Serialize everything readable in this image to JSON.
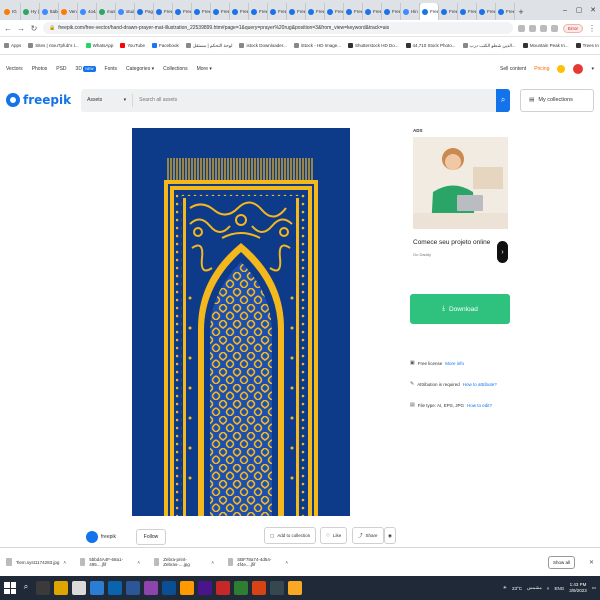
{
  "browser": {
    "tabs": [
      {
        "label": "IG",
        "fav": "o"
      },
      {
        "label": "Hy (3)",
        "fav": "g"
      },
      {
        "label": "ttabdi4",
        "fav": ""
      },
      {
        "label": "Vendor",
        "fav": "o"
      },
      {
        "label": "4o4ad",
        "fav": ""
      },
      {
        "label": "music",
        "fav": "g"
      },
      {
        "label": "studio",
        "fav": ""
      },
      {
        "label": "Page",
        "fav": "f"
      },
      {
        "label": "Free",
        "fav": "f"
      },
      {
        "label": "Free",
        "fav": "f"
      },
      {
        "label": "Free",
        "fav": "f"
      },
      {
        "label": "Free",
        "fav": "f"
      },
      {
        "label": "Free",
        "fav": "f"
      },
      {
        "label": "Free",
        "fav": "f"
      },
      {
        "label": "Free",
        "fav": "f"
      },
      {
        "label": "Free",
        "fav": "f"
      },
      {
        "label": "Free",
        "fav": "f"
      },
      {
        "label": "Free",
        "fav": "f"
      },
      {
        "label": "Free",
        "fav": "f"
      },
      {
        "label": "Free",
        "fav": "f"
      },
      {
        "label": "Free",
        "fav": "f"
      },
      {
        "label": "Hin",
        "fav": ""
      },
      {
        "label": "Free",
        "fav": "f"
      },
      {
        "label": "Free",
        "fav": "f"
      },
      {
        "label": "Free",
        "fav": "f"
      },
      {
        "label": "Free",
        "fav": "f"
      },
      {
        "label": "Free",
        "fav": "f"
      }
    ],
    "url": "freepik.com/free-vector/hand-drawn-prayer-mat-illustration_22539899.htm#page=1&query=prayer%20rug&position=3&from_view=keyword&track=ais",
    "error_label": "Error"
  },
  "bookmarks": [
    {
      "label": "Apps",
      "icon": "apps-icon",
      "c": ""
    },
    {
      "label": "Sites | ntouTpfub's t...",
      "icon": "site-icon",
      "c": ""
    },
    {
      "label": "WhatsApp",
      "icon": "whatsapp-icon",
      "c": "w"
    },
    {
      "label": "YouTube",
      "icon": "youtube-icon",
      "c": "y"
    },
    {
      "label": "Facebook",
      "icon": "facebook-icon",
      "c": "b"
    },
    {
      "label": "لوحة التحكم | مستقل",
      "icon": "mostaql-icon",
      "c": ""
    },
    {
      "label": "istock Downloader...",
      "icon": "istock-icon",
      "c": ""
    },
    {
      "label": "iStock - HD Image...",
      "icon": "istock-icon",
      "c": ""
    },
    {
      "label": "Shutterstock HD Do...",
      "icon": "shutterstock-icon",
      "c": "s"
    },
    {
      "label": "44,710 Stock Photo...",
      "icon": "shutterstock-icon",
      "c": "s"
    },
    {
      "label": "الذين شطو الكتب درب...",
      "icon": "site-icon",
      "c": ""
    },
    {
      "label": "Mountain Peak In...",
      "icon": "shutterstock-icon",
      "c": "s"
    },
    {
      "label": "Trees In Autumn Wi...",
      "icon": "shutterstock-icon",
      "c": "s"
    },
    {
      "label": "Set Of Three Multi...",
      "icon": "shutterstock-icon",
      "c": "s"
    }
  ],
  "topnav": {
    "items": [
      "Vectors",
      "Photos",
      "PSD",
      "3D",
      "Fonts",
      "Categories",
      "Collections",
      "More"
    ],
    "new_badge": "NEW",
    "sell": "Sell content",
    "pricing": "Pricing"
  },
  "header": {
    "logo": "freepik",
    "search_type": "Assets",
    "search_placeholder": "Search all assets",
    "collections": "My collections"
  },
  "ads": {
    "label": "ADS",
    "title": "Comece seu projeto online",
    "sub": "Go Daddy"
  },
  "download": {
    "label": "Download"
  },
  "info": {
    "license": "Free license",
    "license_link": "More info",
    "attribution": "Attribution is required",
    "attribution_link": "How to attribute?",
    "filetype": "File type: AI, EPS, JPG",
    "filetype_link": "How to edit?"
  },
  "author": {
    "name": "freepik",
    "follow": "Follow"
  },
  "actions": {
    "add": "Add to collection",
    "like": "Like",
    "share": "Share"
  },
  "shelf": {
    "items": [
      "Tiem.syst1174283.jpg",
      "5bbd4A4F-68a1-495....jfif",
      "Zebra-print-Zebras-....jpg",
      "SBF78a74-4d54-4f4e....jfif"
    ],
    "show_all": "Show all"
  },
  "taskbar": {
    "weather": "23°C",
    "weather_label": "مشمس",
    "lang": "ENG",
    "time": "1:43 PM",
    "date": "3/9/2023"
  },
  "colors": {
    "rug_blue": "#0d3b8a",
    "rug_gold": "#f4b81c",
    "download_green": "#2ec27e",
    "freepik_blue": "#1273eb"
  }
}
